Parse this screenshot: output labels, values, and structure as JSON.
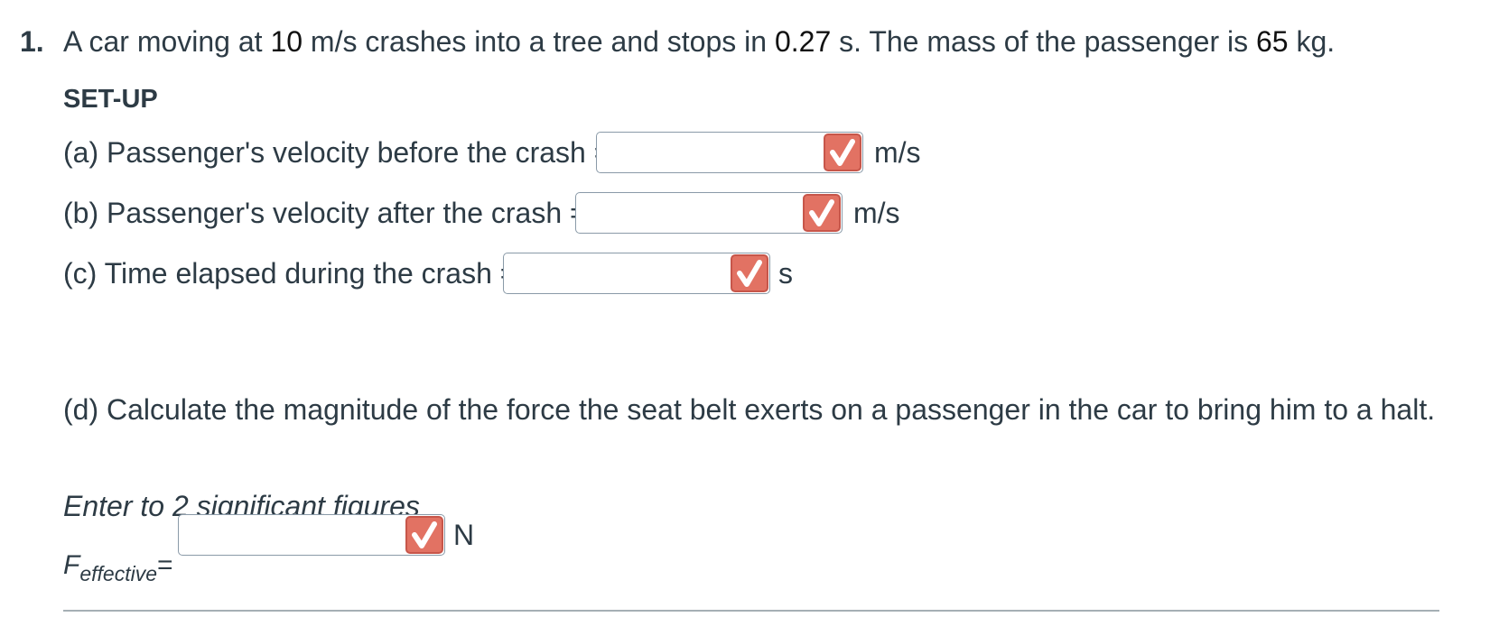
{
  "question": {
    "number": "1.",
    "text_parts": [
      "A car moving at ",
      "10",
      " m/s crashes into a tree and stops in ",
      "0.27",
      " s.  The mass of the passenger is ",
      "65",
      " kg."
    ]
  },
  "setup_heading": "SET-UP",
  "parts": [
    {
      "label": "(a) Passenger's velocity before the crash =",
      "value": "",
      "unit": "m/s"
    },
    {
      "label": "(b) Passenger's velocity after the crash =",
      "value": "",
      "unit": "m/s"
    },
    {
      "label": "(c) Time elapsed during the crash =",
      "value": "",
      "unit": "s"
    }
  ],
  "part_d": {
    "text": "(d) Calculate the magnitude of the force the seat belt exerts on a passenger in the car to bring him to a halt.",
    "instruction": "Enter to 2 significant figures",
    "symbol": "F",
    "subscript": "effective",
    "equals": "=",
    "value": "",
    "unit": "N"
  },
  "icons": {
    "answer_status": "checkmark-icon"
  },
  "colors": {
    "status_badge": "#e27263",
    "text": "#2d3b45"
  }
}
